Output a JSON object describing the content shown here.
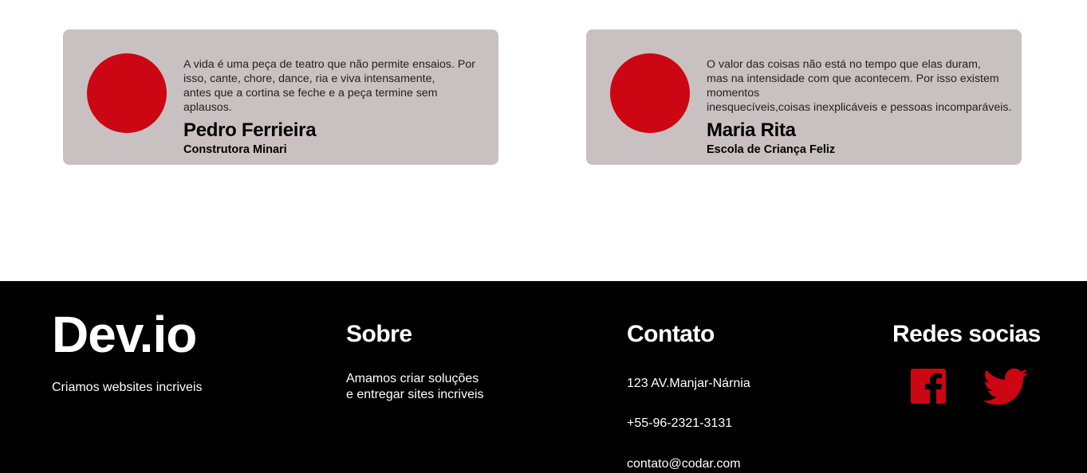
{
  "testimonials": [
    {
      "quote_lines": [
        "A vida é uma peça de teatro que não permite ensaios. Por",
        "isso, cante, chore, dance, ria e viva intensamente,",
        "antes que a cortina se feche e a peça termine sem",
        "aplausos."
      ],
      "name": "Pedro Ferrieira",
      "company": "Construtora Minari"
    },
    {
      "quote_lines": [
        "O valor das coisas não está no tempo que elas duram,",
        "mas na intensidade com que acontecem. Por isso existem",
        "momentos",
        "inesquecíveis,coisas inexplicáveis e pessoas incomparáveis."
      ],
      "name": "Maria Rita",
      "company": "Escola de Criança Feliz"
    }
  ],
  "footer": {
    "brand": "Dev.io",
    "tagline": "Criamos websites incriveis",
    "sobre": {
      "title": "Sobre",
      "lines": [
        "Amamos criar soluções",
        "e entregar sites incriveis"
      ]
    },
    "contato": {
      "title": "Contato",
      "address": "123 AV.Manjar-Nárnia",
      "phone": "+55-96-2321-3131",
      "email": "contato@codar.com"
    },
    "redes": {
      "title": "Redes socias",
      "icons": [
        "facebook-icon",
        "twitter-icon"
      ]
    }
  },
  "colors": {
    "accent": "#cc0612",
    "card_bg": "#c9c1c1",
    "footer_bg": "#000000"
  }
}
